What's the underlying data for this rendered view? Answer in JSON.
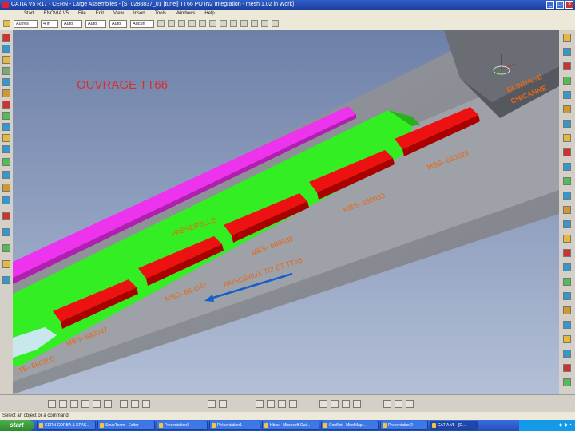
{
  "window": {
    "title": "CATIA V5 R17 - CERN - Large Assemblies - [ST0288837_01 [tunel] TT66 PO IN2 Integration - mesh 1.02 in Work]",
    "app_icon": "catia-logo-icon",
    "buttons": [
      "minimize-icon",
      "maximize-icon",
      "close-icon"
    ]
  },
  "menu": [
    "Start",
    "ENOVIA V5",
    "File",
    "Edit",
    "View",
    "Insert",
    "Tools",
    "Windows",
    "Help"
  ],
  "toolbar": {
    "selects": [
      "Autres",
      "4 ln",
      "Auto",
      "Auto",
      "Auto",
      "Aucun"
    ]
  },
  "viewport": {
    "title": "OUVRAGE TT66",
    "labels": {
      "blindage": "BLINDAGE",
      "chicanne": "CHICANNE",
      "passerelle": "PASSERELLE",
      "faisceaux": "FAISCEAUX TI2 ET TT66",
      "qtb": "QTB- 660100"
    },
    "magnets": [
      "MBS- 660029",
      "MBS- 660033",
      "MBS- 660038",
      "MBS- 660042",
      "MBS- 660047"
    ],
    "colors": {
      "magnet": "#ee1111",
      "floor_green": "#33ee22",
      "beam_pink": "#ee33ee",
      "label_orange": "#e0691b",
      "title_red": "#d83030",
      "arrow_blue": "#1560c8",
      "tunnel_grey": "#8a8d94"
    }
  },
  "status": {
    "prompt": "Select an object or a command"
  },
  "taskbar": {
    "start_label": "start",
    "items": [
      "CERN CORBA & SPAS...",
      "SmarTeam - Editor",
      "Presentation2",
      "Présentation1",
      "Hbox - Microsoft Out...",
      "Conflict - MindMap...",
      "Presentation2",
      "CATIA V5 - [D..."
    ],
    "tray_icons": [
      "network-icon",
      "volume-icon",
      "clock-icon"
    ]
  }
}
